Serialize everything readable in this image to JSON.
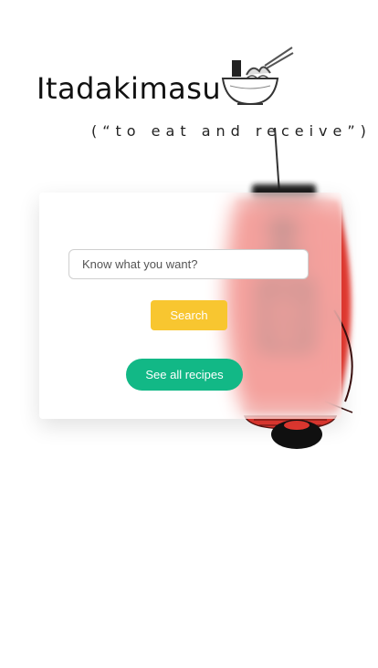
{
  "header": {
    "title": "Itadakimasu",
    "subtitle": "(“to eat and receive”)"
  },
  "search": {
    "placeholder": "Know what you want?",
    "value": "",
    "button_label": "Search"
  },
  "actions": {
    "see_all_label": "See all recipes"
  },
  "colors": {
    "search_button": "#f8c630",
    "see_all_button": "#12b886",
    "lantern": "#e83a32"
  },
  "icons": {
    "bowl": "ramen-bowl-icon",
    "lantern": "paper-lantern-illustration"
  }
}
